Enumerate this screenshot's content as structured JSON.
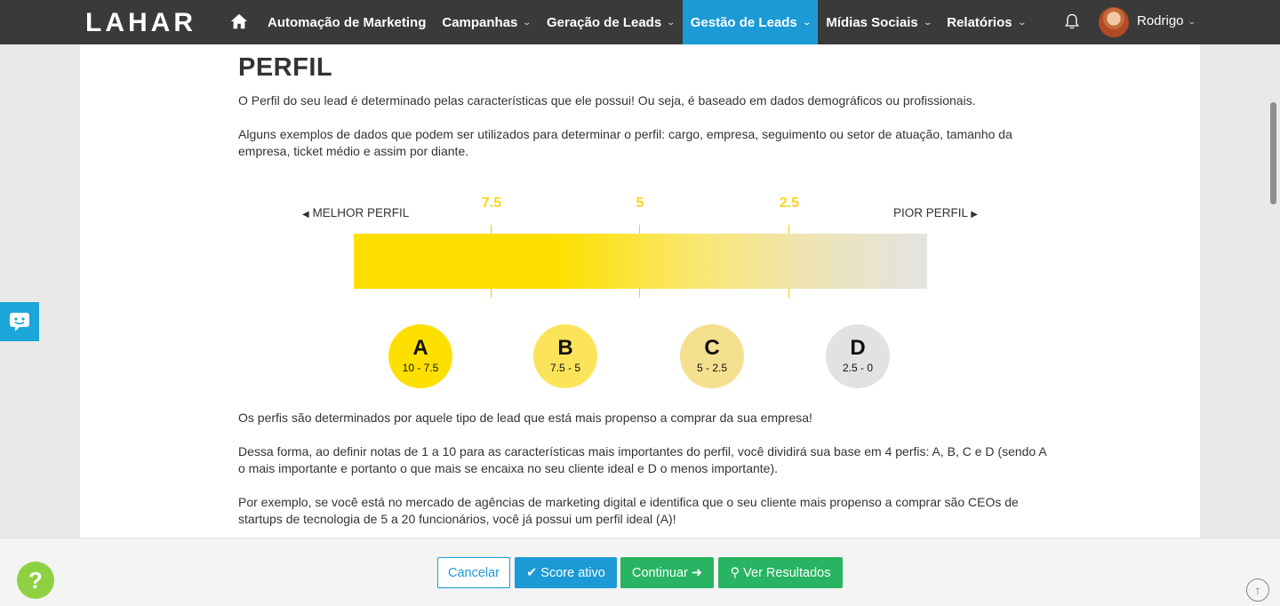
{
  "nav": {
    "logo": "LAHAR",
    "home_icon": "home-icon",
    "items": [
      {
        "label": "Automação de Marketing",
        "dropdown": false,
        "active": false
      },
      {
        "label": "Campanhas",
        "dropdown": true,
        "active": false
      },
      {
        "label": "Geração de Leads",
        "dropdown": true,
        "active": false
      },
      {
        "label": "Gestão de Leads",
        "dropdown": true,
        "active": true
      },
      {
        "label": "Mídias Sociais",
        "dropdown": true,
        "active": false
      },
      {
        "label": "Relatórios",
        "dropdown": true,
        "active": false
      }
    ],
    "bell_icon": "bell-icon",
    "user_name": "Rodrigo",
    "active_color": "#1b9ad6"
  },
  "page": {
    "title": "PERFIL",
    "paragraphs": {
      "p1": "O Perfil do seu lead é determinado pelas características que ele possui! Ou seja, é baseado em dados demográficos ou profissionais.",
      "p2": "Alguns exemplos de dados que podem ser utilizados para determinar o perfil: cargo, empresa, seguimento ou setor de atuação, tamanho da empresa, ticket médio e assim por diante.",
      "p3": "Os perfis são determinados por aquele tipo de lead que está mais propenso a comprar da sua empresa!",
      "p4": "Dessa forma, ao definir notas de 1 a 10 para as características mais importantes do perfil, você dividirá sua base em 4 perfis: A, B, C e D (sendo A o mais importante e portanto o que mais se encaixa no seu cliente ideal e D o menos importante).",
      "p5": "Por exemplo, se você está no mercado de agências de marketing digital e identifica que o seu cliente mais propenso a comprar são CEOs de startups de tecnologia de 5 a 20 funcionários, você já possui um perfil ideal (A)!"
    }
  },
  "scale": {
    "best_label": "MELHOR PERFIL",
    "worst_label": "PIOR PERFIL",
    "ticks": [
      "7.5",
      "5",
      "2.5"
    ],
    "tick_color": "#fbd51a",
    "profiles": [
      {
        "letter": "A",
        "range": "10 - 7.5",
        "color": "#fde000"
      },
      {
        "letter": "B",
        "range": "7.5 - 5",
        "color": "#fbe45a"
      },
      {
        "letter": "C",
        "range": "5 - 2.5",
        "color": "#f5e08f"
      },
      {
        "letter": "D",
        "range": "2.5 - 0",
        "color": "#e2e2e2"
      }
    ]
  },
  "footer": {
    "cancel": "Cancelar",
    "score": "Score ativo",
    "continue": "Continuar",
    "results": "Ver Resultados",
    "blue": "#1b9ad6",
    "green": "#28b462"
  },
  "widgets": {
    "chat_icon": "chat-icon",
    "help_text": "?",
    "scrolltop_icon": "arrow-up-icon"
  }
}
